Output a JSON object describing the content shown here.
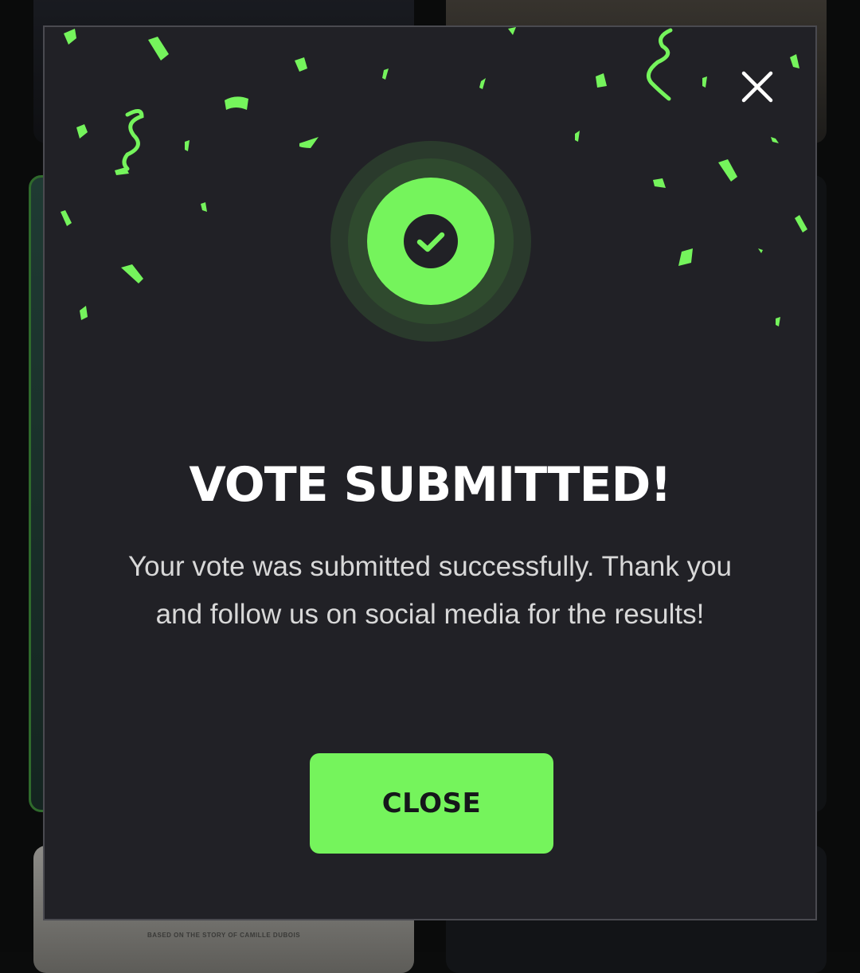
{
  "modal": {
    "title": "VOTE SUBMITTED!",
    "message": "Your vote was submitted successfully. Thank you and follow us on social media for the results!",
    "close_button_label": "CLOSE",
    "close_icon": "close-icon",
    "success_icon": "check-circle-icon"
  },
  "background": {
    "card_caption": "BASED ON THE STORY OF CAMILLE DUBOIS"
  },
  "colors": {
    "accent": "#75f45c",
    "modal_background": "#212126",
    "title_text": "#ffffff",
    "body_text": "#d8d8d8"
  }
}
